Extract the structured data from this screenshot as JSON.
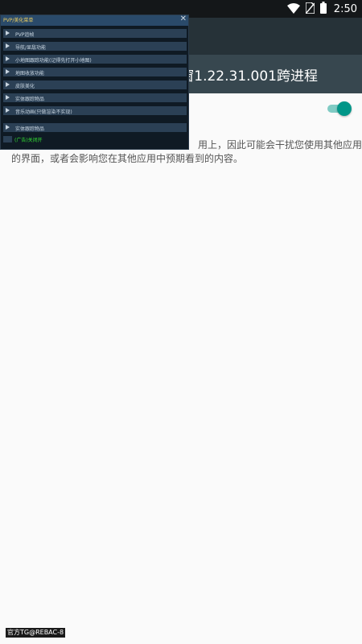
{
  "status_bar": {
    "time": "2:50",
    "icons": [
      "wifi-icon",
      "no-sim-icon",
      "battery-icon"
    ],
    "background": "#141719"
  },
  "app_bar": {
    "title": "浮窗1.22.31.001跨进程",
    "colors": {
      "top": "#263238",
      "title_area": "#37474f"
    }
  },
  "setting": {
    "toggle_on": true,
    "accent": "#009688",
    "description_line1": "用上，因此可能会干扰您使用其他应用",
    "description_line2": "的界面，或者会影响您在其他应用中预期看到的内容。"
  },
  "float_menu": {
    "title": "PVP/美化菜单",
    "close_symbol": "✕",
    "items": [
      "PVP追帧",
      "导航/显敌功能",
      "小地图跟踪功能(记得先打开小地图)",
      "地图收放功能",
      "皮肤美化",
      "实体跟踪物品",
      "音乐动画(只做渲染不实现)",
      "实体跟踪物品"
    ],
    "checkbox_label": "(广告)关闭开"
  },
  "watermark": "官方TG@REBAC-8"
}
